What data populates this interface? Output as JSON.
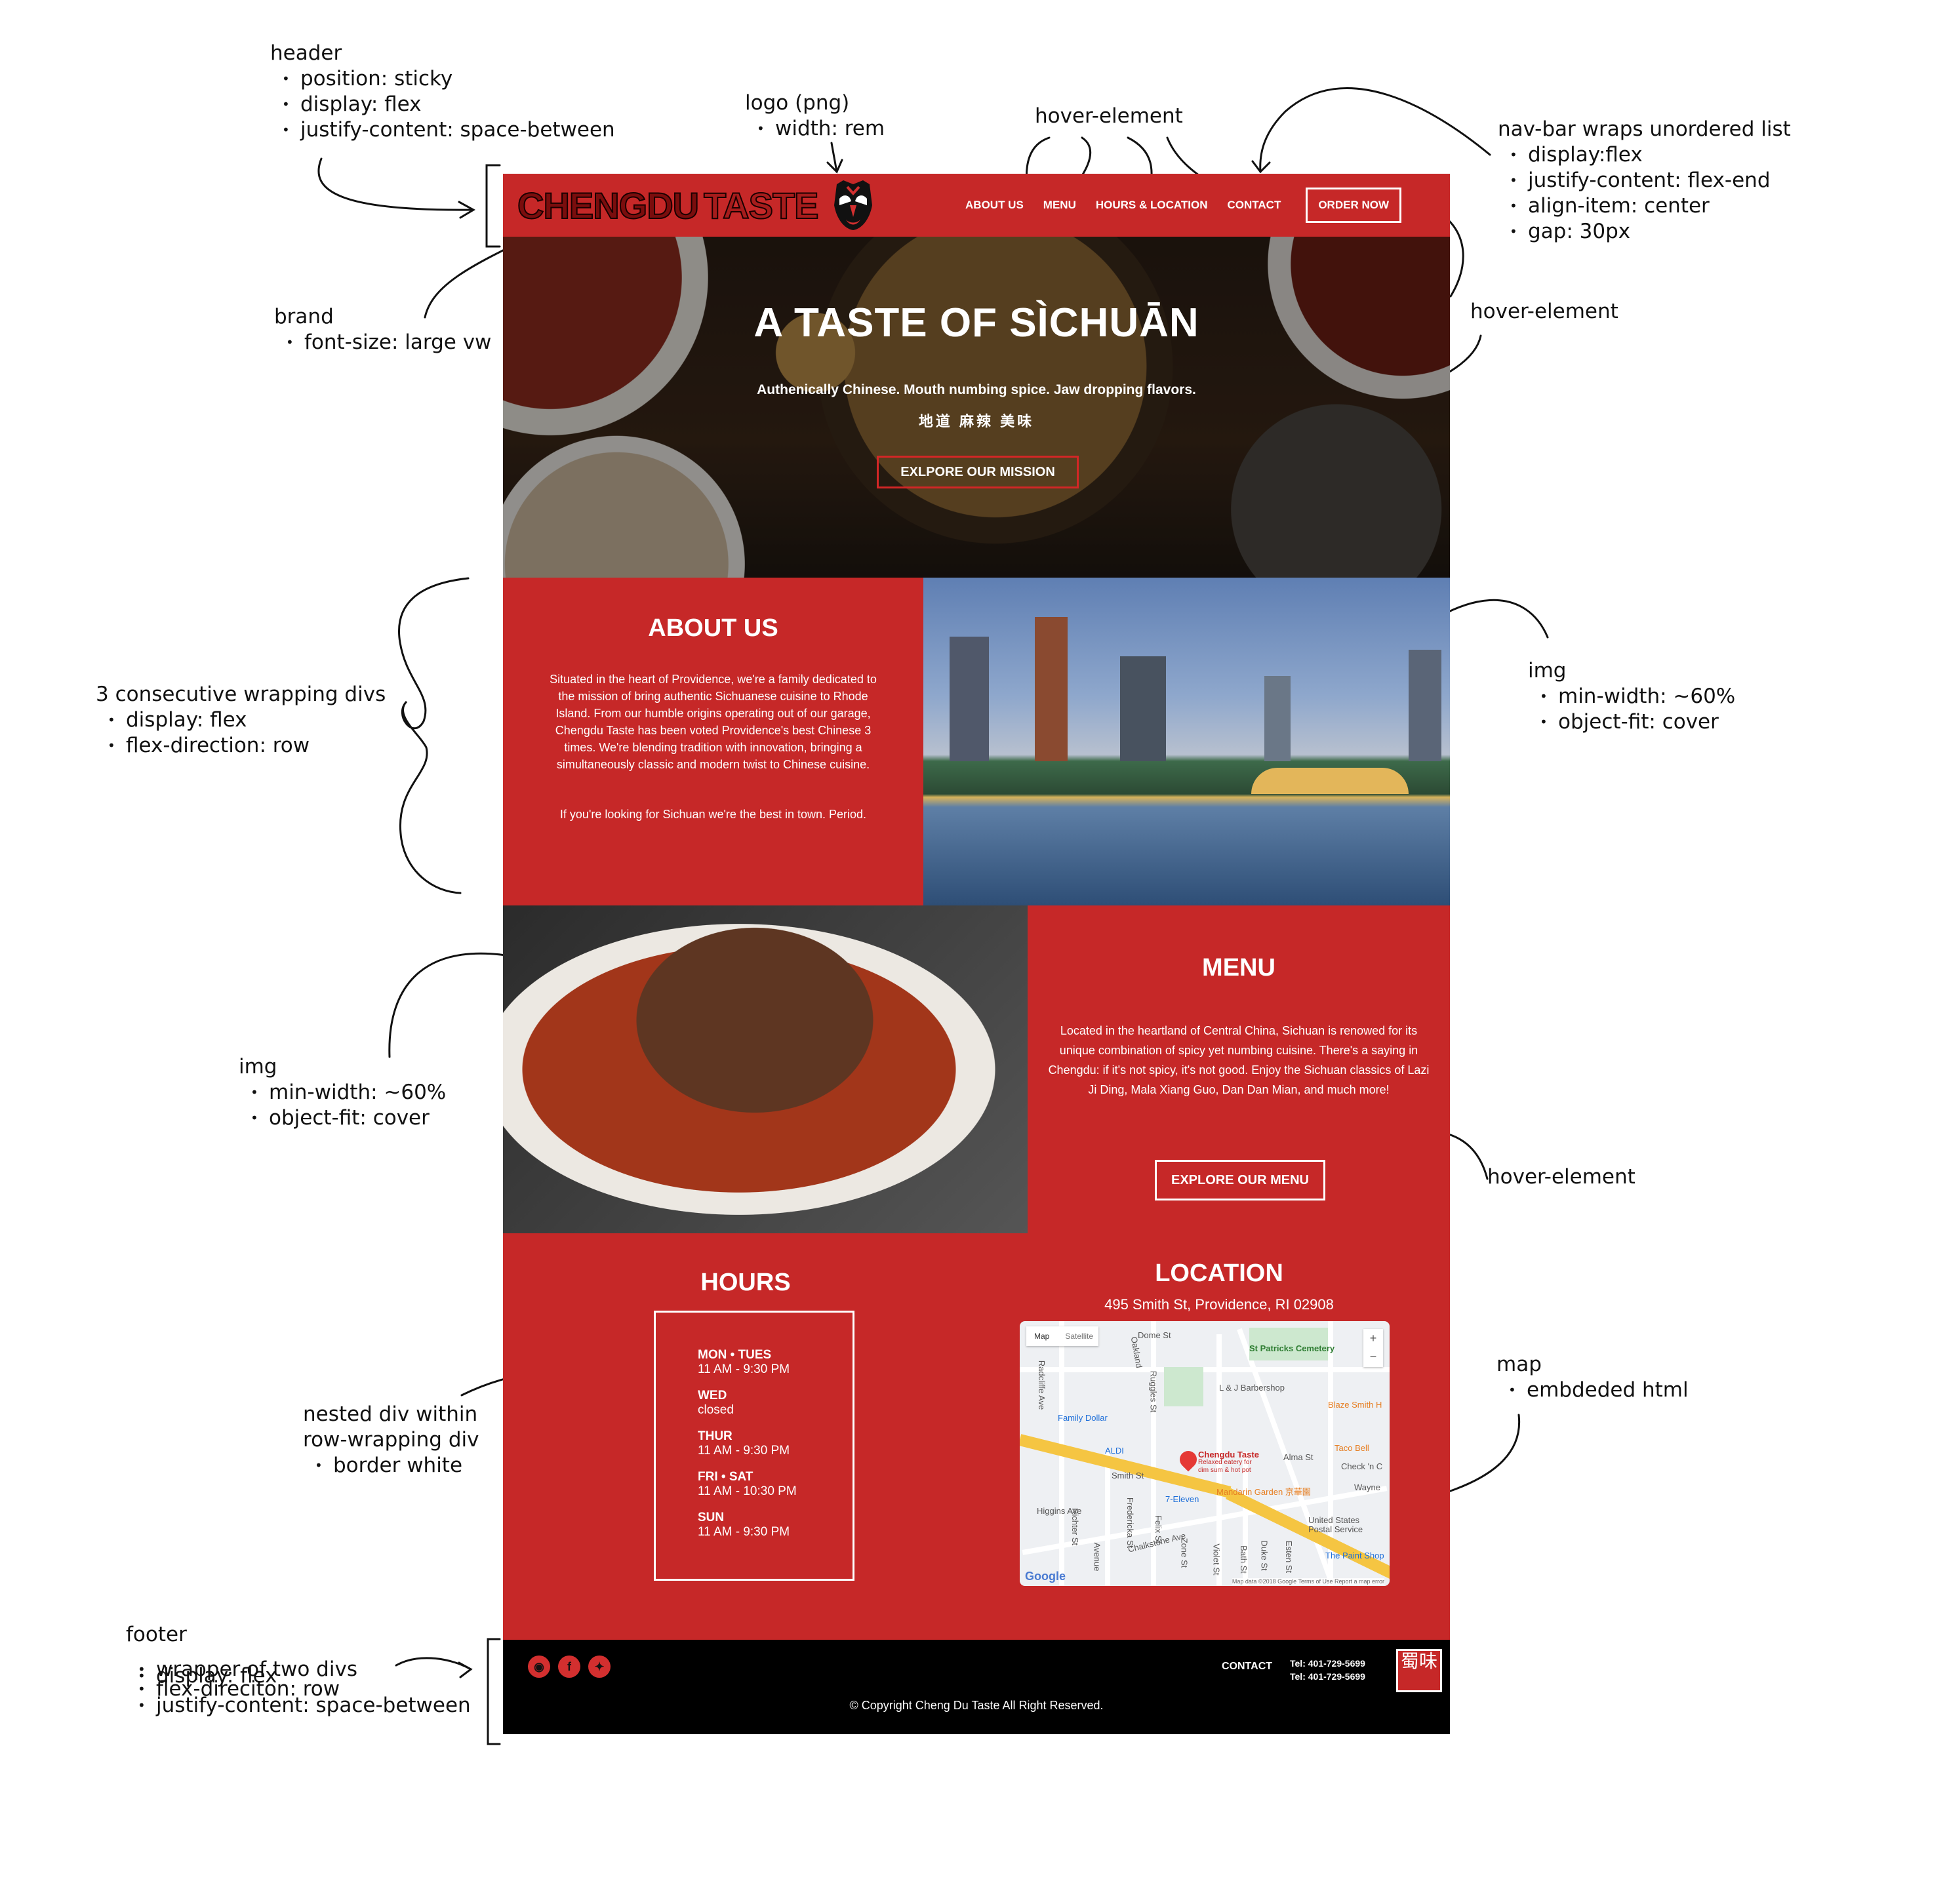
{
  "annotations": {
    "header": {
      "title": "header",
      "items": [
        "position: sticky",
        "display: flex",
        "justify-content: space-between"
      ]
    },
    "logo": {
      "title": "logo (png)",
      "items": [
        "width: rem"
      ]
    },
    "hover_top": {
      "title": "hover-element"
    },
    "navbar": {
      "title": "nav-bar wraps unordered list",
      "items": [
        "display:flex",
        "justify-content: flex-end",
        "align-item: center",
        "gap: 30px"
      ]
    },
    "brand": {
      "title": "brand",
      "items": [
        "font-size: large vw"
      ]
    },
    "hover_right": {
      "title": "hover-element"
    },
    "wrapping": {
      "title": "3 consecutive wrapping divs",
      "items": [
        "display: flex",
        "flex-direction: row"
      ]
    },
    "img_right": {
      "title": "img",
      "items": [
        "min-width: ~60%",
        "object-fit: cover"
      ]
    },
    "img_left": {
      "title": "img",
      "items": [
        "min-width: ~60%",
        "object-fit: cover"
      ]
    },
    "hover_menu": {
      "title": "hover-element"
    },
    "map": {
      "title": "map",
      "items": [
        "embdeded html"
      ]
    },
    "nested": {
      "title_line1": "nested div within",
      "title_line2": "row-wrapping div",
      "items": [
        "border white"
      ]
    },
    "footer": {
      "title": "footer",
      "items": [
        "wrapper of two divs",
        "display: flex",
        "flex-direciton: row",
        "justify-content: space-between"
      ]
    }
  },
  "site": {
    "brand_part1": "CHENGDU",
    "brand_part2": "TASTE",
    "nav": {
      "about": "ABOUT US",
      "menu": "MENU",
      "hours": "HOURS & LOCATION",
      "contact": "CONTACT",
      "order": "ORDER NOW"
    },
    "hero": {
      "title": "A TASTE OF SÌCHUĀN",
      "subtitle": "Authenically Chinese. Mouth numbing spice. Jaw dropping flavors.",
      "chinese": "地道 麻辣 美味",
      "button": "EXLPORE OUR MISSION"
    },
    "about": {
      "title": "ABOUT US",
      "p1": "Situated in the heart of Providence, we're a family dedicated to the mission of bring authentic Sichuanese cuisine to Rhode Island. From our humble origins operating out of our garage, Chengdu Taste has been voted Providence's best Chinese 3 times. We're blending tradition with innovation, bringing a simultaneously classic and modern twist to Chinese cuisine.",
      "p2": "If you're looking for Sichuan we're the best in town. Period."
    },
    "menu": {
      "title": "MENU",
      "text": "Located in the heartland of Central China, Sichuan is renowed for its unique combination of spicy yet numbing cuisine. There's a saying in Chengdu: if it's not spicy, it's not good. Enjoy the Sichuan classics of Lazi Ji Ding, Mala Xiang Guo, Dan Dan Mian, and much more!",
      "button": "EXPLORE OUR MENU"
    },
    "hours": {
      "title": "HOURS",
      "rows": [
        {
          "day": "MON • TUES",
          "time": "11 AM - 9:30 PM"
        },
        {
          "day": "WED",
          "time": "closed"
        },
        {
          "day": "THUR",
          "time": "11 AM - 9:30 PM"
        },
        {
          "day": "FRI • SAT",
          "time": "11 AM - 10:30 PM"
        },
        {
          "day": "SUN",
          "time": "11 AM - 9:30 PM"
        }
      ]
    },
    "location": {
      "title": "LOCATION",
      "address": "495 Smith St, Providence, RI 02908",
      "map": {
        "tab_map": "Map",
        "tab_satellite": "Satellite",
        "zoom_in": "+",
        "zoom_out": "−",
        "labels": {
          "dome": "Dome St",
          "oakland": "Oakland",
          "st_patricks": "St Patricks Cemetery",
          "lj_barbershop": "L & J Barbershop",
          "blaze": "Blaze Smith H",
          "family_dollar": "Family Dollar",
          "aldi": "ALDI",
          "chengdu": "Chengdu Taste",
          "chengdu_sub1": "Relaxed eatery for",
          "chengdu_sub2": "dim sum & hot pot",
          "taco_bell": "Taco Bell",
          "check": "Check 'n C",
          "alma": "Alma St",
          "smith": "Smith St",
          "mandarin": "Mandarin Garden 京華園",
          "seven_eleven": "7-Eleven",
          "higgins": "Higgins Ave",
          "chalkstone": "Chalkstone Ave",
          "usps1": "United States",
          "usps2": "Postal Service",
          "paint_shop": "The Paint Shop",
          "wayne": "Wayne",
          "radcliffe": "Radcliffe Ave",
          "ruggles": "Ruggles St",
          "fredericka": "Fredericka St",
          "felix": "Felix St",
          "zone": "Zone St",
          "violet": "Violet St",
          "bath": "Bath St",
          "duke": "Duke St",
          "esten": "Esten St",
          "richter": "Richter St",
          "avenue": "Avenue",
          "google": "Google",
          "credits": "Map data ©2018 Google   Terms of Use   Report a map error"
        }
      }
    },
    "footer": {
      "social": [
        "instagram-icon",
        "facebook-icon",
        "twitter-icon"
      ],
      "contact": "CONTACT",
      "tel1": "Tel: 401-729-5699",
      "tel2": "Tel: 401-729-5699",
      "seal": "蜀味",
      "copyright": "© Copyright Cheng Du Taste All Right Reserved."
    },
    "colors": {
      "primary_red": "#c62828",
      "footer_black": "#000000",
      "text_white": "#ffffff"
    }
  }
}
